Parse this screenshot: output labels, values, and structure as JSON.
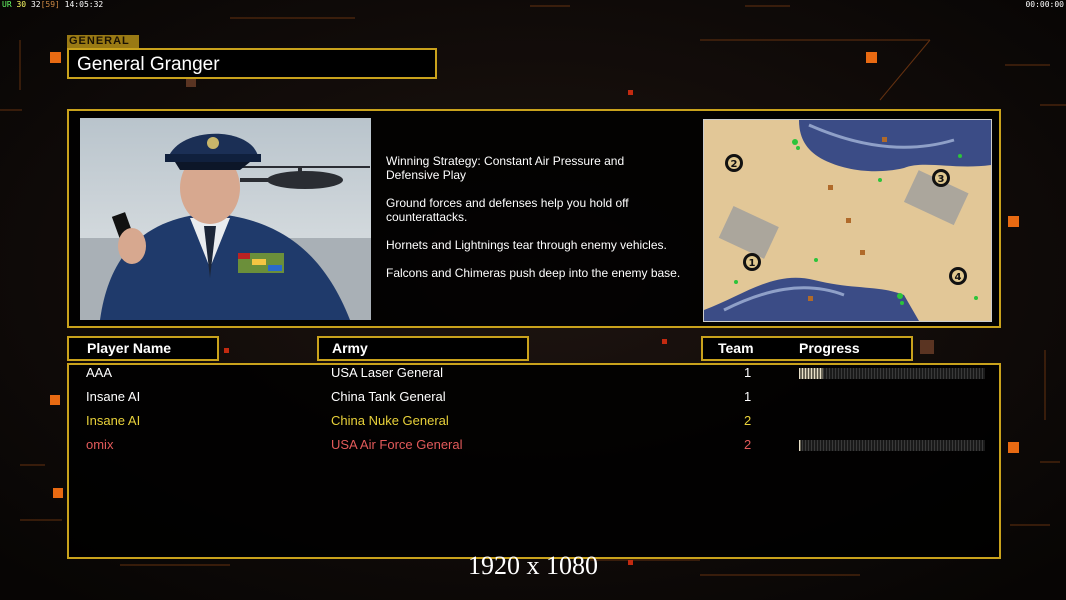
{
  "hud": {
    "fps_label": "UR",
    "fps_a": "30",
    "fps_b": "32",
    "fps_c": "[59]",
    "clock": "14:05:32",
    "timer": "00:00:00"
  },
  "general": {
    "tag": "GENERAL",
    "name": "General Granger",
    "strategy": [
      "Winning Strategy: Constant Air Pressure and\n Defensive Play",
      "Ground forces and defenses help you hold off\n counterattacks.",
      "Hornets and Lightnings tear through enemy vehicles.",
      "Falcons and Chimeras push deep into the enemy base."
    ]
  },
  "minimap": {
    "start_positions": [
      "1",
      "2",
      "3",
      "4"
    ]
  },
  "table": {
    "headers": {
      "player": "Player Name",
      "army": "Army",
      "team": "Team",
      "progress": "Progress"
    },
    "rows": [
      {
        "name": "AAA",
        "army": "USA Laser General",
        "team": "1",
        "color": "#ffffff",
        "progress": 0.13
      },
      {
        "name": "Insane AI",
        "army": "China Tank General",
        "team": "1",
        "color": "#ffffff",
        "progress": null
      },
      {
        "name": "Insane AI",
        "army": "China Nuke General",
        "team": "2",
        "color": "#e8d13a",
        "progress": null
      },
      {
        "name": "omix",
        "army": "USA Air Force General",
        "team": "2",
        "color": "#e25a5a",
        "progress": 0.01
      }
    ]
  },
  "resolution_label": "1920 x 1080"
}
